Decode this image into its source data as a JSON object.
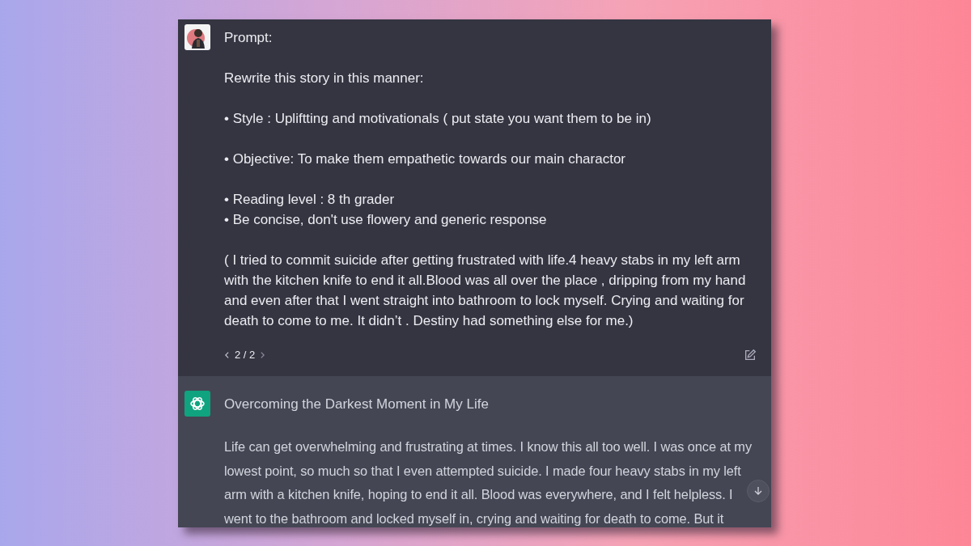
{
  "prompt": {
    "blocks": [
      {
        "kind": "text",
        "text": "Prompt:"
      },
      {
        "kind": "text",
        "text": "Rewrite this story in this manner:"
      },
      {
        "kind": "bullets",
        "items": [
          "• Style : Upliftting and motivationals ( put state you want them to be in)"
        ]
      },
      {
        "kind": "bullets",
        "items": [
          "• Objective: To make them empathetic towards our main charactor"
        ]
      },
      {
        "kind": "bullets",
        "items": [
          "• Reading level : 8 th grader",
          "• Be concise, don't use flowery and generic response"
        ]
      },
      {
        "kind": "text",
        "text": "( I tried to commit suicide after getting frustrated with life.4 heavy stabs in my left arm with the kitchen knife to end it all.Blood was all over the place , dripping from my hand and even after that I went straight into bathroom to lock myself. Crying and waiting for death to come to me. It didn’t . Destiny had something else for me.)"
      }
    ],
    "pager": "2 / 2"
  },
  "response": {
    "title": "Overcoming the Darkest Moment in My Life",
    "paragraphs": [
      "Life can get overwhelming and frustrating at times. I know this all too well. I was once at my lowest point, so much so that I even attempted suicide. I made four heavy stabs in my left arm with a kitchen knife, hoping to end it all. Blood was everywhere, and I felt helpless. I went to the bathroom and locked myself in, crying and waiting for death to come. But it"
    ]
  }
}
